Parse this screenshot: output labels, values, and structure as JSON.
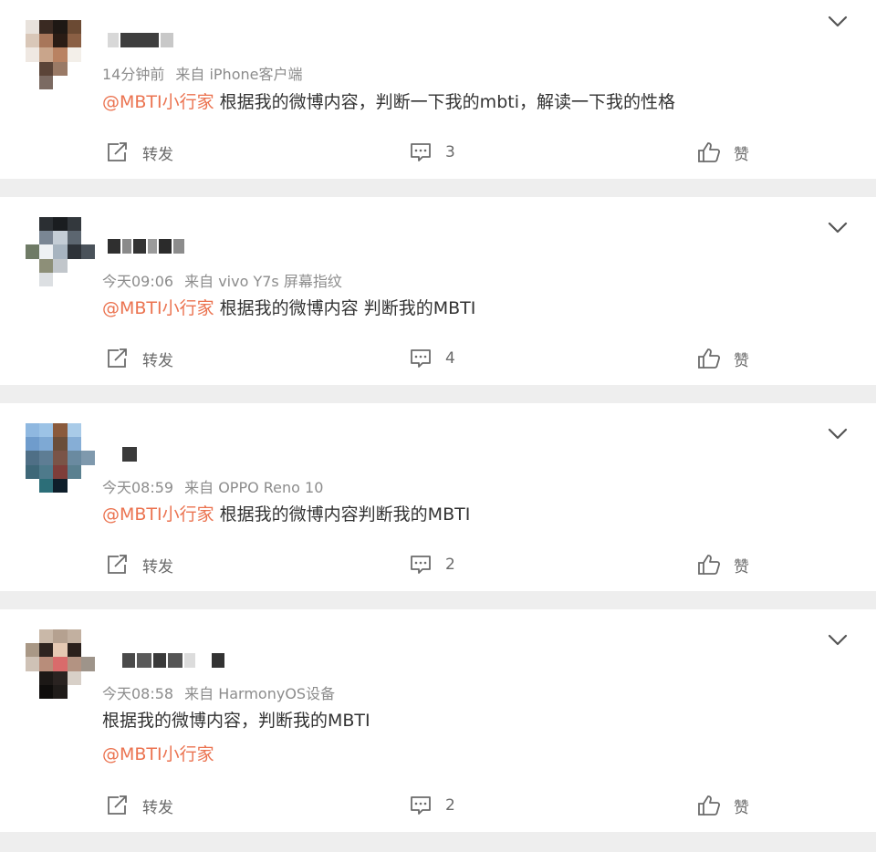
{
  "colors": {
    "mention": "#eb7350",
    "meta": "#8c8c8c",
    "text": "#333333",
    "action": "#6b6b6b",
    "background": "#eeeeee"
  },
  "icons": {
    "more": "chevron-down-icon",
    "repost": "share-arrow-icon",
    "comment": "comment-bubble-icon",
    "like": "thumbs-up-icon"
  },
  "posts": [
    {
      "meta_time": "14分钟前",
      "meta_source": "来自 iPhone客户端",
      "line1_mention": "@MBTI小行家",
      "line1_text": " 根据我的微博内容，判断一下我的mbti，解读一下我的性格",
      "repost_label": "转发",
      "comment_count": "3",
      "like_label": "赞"
    },
    {
      "meta_time": "今天09:06",
      "meta_source": "来自 vivo Y7s 屏幕指纹",
      "line1_mention": "@MBTI小行家",
      "line1_text": " 根据我的微博内容 判断我的MBTI",
      "repost_label": "转发",
      "comment_count": "4",
      "like_label": "赞"
    },
    {
      "meta_time": "今天08:59",
      "meta_source": "来自 OPPO Reno 10",
      "line1_mention": "@MBTI小行家",
      "line1_text": " 根据我的微博内容判断我的MBTI",
      "repost_label": "转发",
      "comment_count": "2",
      "like_label": "赞"
    },
    {
      "meta_time": "今天08:58",
      "meta_source": "来自 HarmonyOS设备",
      "line1_text": "根据我的微博内容，判断我的MBTI",
      "line2_mention": "@MBTI小行家",
      "repost_label": "转发",
      "comment_count": "2",
      "like_label": "赞"
    }
  ]
}
